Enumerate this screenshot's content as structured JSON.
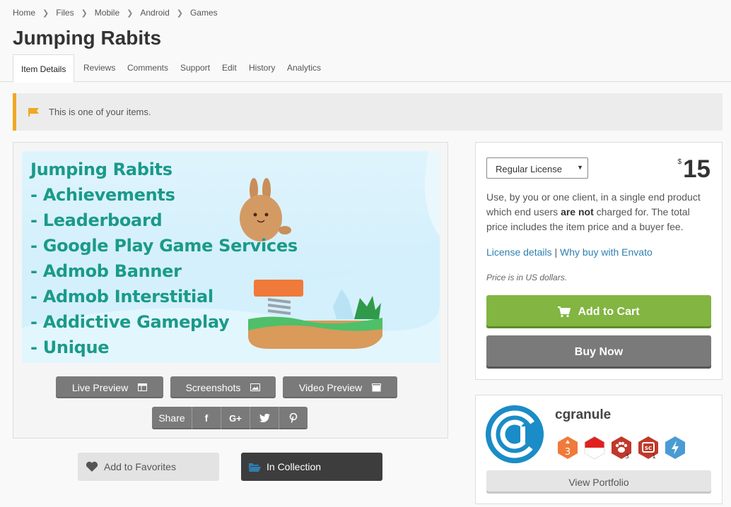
{
  "breadcrumb": [
    "Home",
    "Files",
    "Mobile",
    "Android",
    "Games"
  ],
  "title": "Jumping Rabits",
  "tabs": [
    "Item Details",
    "Reviews",
    "Comments",
    "Support",
    "Edit",
    "History",
    "Analytics"
  ],
  "notice": {
    "text": "This is one of your items.",
    "icon": "flag-icon",
    "accent": "#f0a824"
  },
  "banner": {
    "lines": [
      "Jumping Rabits",
      "- Achievements",
      "- Leaderboard",
      "- Google Play Game Services",
      "- Admob Banner",
      "- Admob Interstitial",
      "- Addictive Gameplay",
      "- Unique"
    ]
  },
  "preview_buttons": {
    "live": "Live Preview",
    "screenshots": "Screenshots",
    "video": "Video Preview"
  },
  "share": {
    "label": "Share",
    "icons": [
      "facebook-icon",
      "google-plus-icon",
      "twitter-icon",
      "pinterest-icon"
    ],
    "glyphs": [
      "f",
      "G+",
      "",
      ""
    ]
  },
  "favorites_label": "Add to Favorites",
  "collection_label": "In Collection",
  "purchase": {
    "license_select": "Regular License",
    "currency": "$",
    "price": "15",
    "description_before": "Use, by you or one client, in a single end product which end users ",
    "description_bold": "are not",
    "description_after": " charged for. The total price includes the item price and a buyer fee.",
    "license_details": "License details",
    "link_separator": "|",
    "why_buy": "Why buy with Envato",
    "price_note": "Price is in US dollars.",
    "add_to_cart": "Add to Cart",
    "buy_now": "Buy Now",
    "accent": "#82b541"
  },
  "author": {
    "name": "cgranule",
    "badge_counts": [
      "3",
      "",
      "3",
      "1",
      ""
    ],
    "view_portfolio": "View Portfolio"
  }
}
